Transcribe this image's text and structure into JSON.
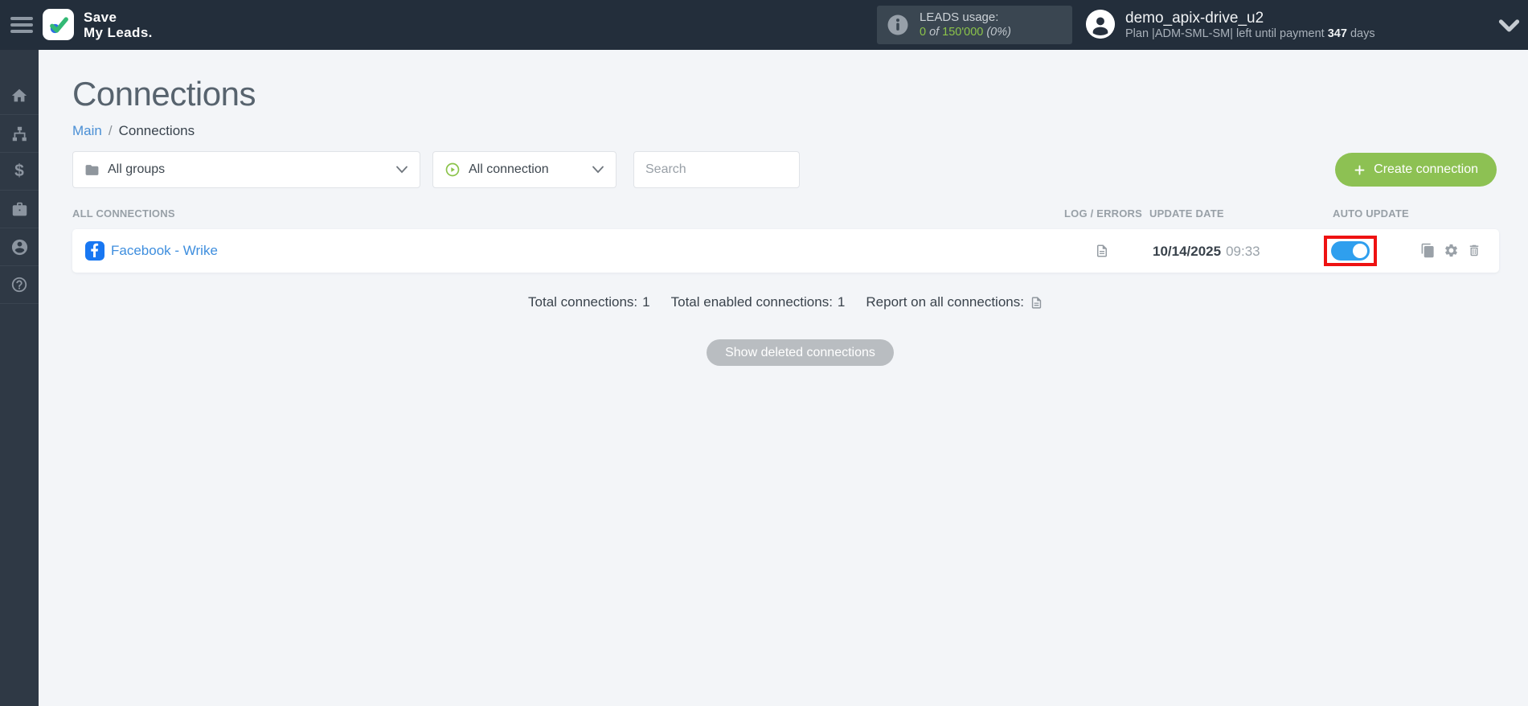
{
  "topbar": {
    "logo": {
      "line1": "Save",
      "line2": "My Leads."
    },
    "leads": {
      "label": "LEADS usage:",
      "used": "0",
      "of": "of",
      "total": "150'000",
      "percent": "(0%)"
    },
    "user": {
      "name": "demo_apix-drive_u2",
      "plan_prefix": "Plan |ADM-SML-SM| left until payment",
      "days": "347",
      "days_suffix": "days"
    }
  },
  "sidebar": {
    "items": [
      {
        "icon": "home-icon"
      },
      {
        "icon": "sitemap-icon"
      },
      {
        "icon": "dollar-icon"
      },
      {
        "icon": "briefcase-icon"
      },
      {
        "icon": "user-icon"
      },
      {
        "icon": "help-icon"
      }
    ]
  },
  "page": {
    "title": "Connections",
    "breadcrumb": {
      "link": "Main",
      "separator": "/",
      "current": "Connections"
    },
    "filters": {
      "groups_label": "All groups",
      "connection_label": "All connection",
      "search_placeholder": "Search"
    },
    "create_button_label": "Create connection",
    "table": {
      "headers": {
        "connections": "ALL CONNECTIONS",
        "log_errors": "LOG / ERRORS",
        "update_date": "UPDATE DATE",
        "auto_update": "AUTO UPDATE"
      },
      "rows": [
        {
          "name": "Facebook - Wrike",
          "source_icon": "facebook-icon",
          "update_date": "10/14/2025",
          "update_time": "09:33",
          "auto_update": true
        }
      ]
    },
    "totals": {
      "connections_label": "Total connections:",
      "connections_value": "1",
      "enabled_label": "Total enabled connections:",
      "enabled_value": "1",
      "report_label": "Report on all connections:"
    },
    "show_deleted_label": "Show deleted connections"
  },
  "colors": {
    "topbar_bg": "#232e3b",
    "sidebar_bg": "#2f3945",
    "accent_green": "#8dc153",
    "leads_green": "#8bc34a",
    "toggle_blue": "#2f9fee",
    "link_blue": "#3e8ede",
    "facebook_blue": "#1877f2",
    "highlight_red": "#ee1212"
  }
}
